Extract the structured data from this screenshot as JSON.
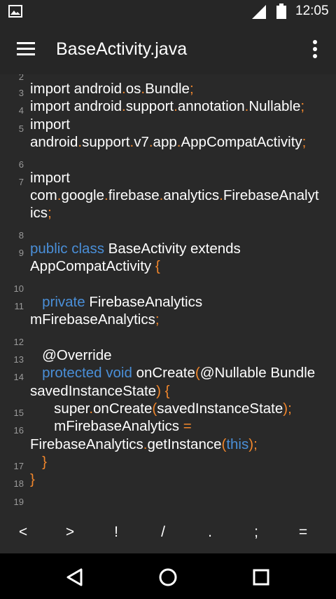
{
  "status_bar": {
    "time": "12:05"
  },
  "toolbar": {
    "title": "BaseActivity.java"
  },
  "editor": {
    "line_numbers": [
      "2",
      "3",
      "4",
      "5",
      "6",
      "7",
      "8",
      "9",
      "10",
      "11",
      "12",
      "13",
      "14",
      "15",
      "16",
      "17",
      "18",
      "19"
    ],
    "code_text": {
      "l3": "import android.os.Bundle;",
      "l4": "import android.support.annotation.Nullable;",
      "l5a": "import",
      "l5b": "android.support.v7.app.AppCompatActivity;",
      "l7a": "import",
      "l7b": "com.google.firebase.analytics.FirebaseAnalyt",
      "l7c": "ics;",
      "l9a": "public class BaseActivity extends",
      "l9b": "AppCompatActivity {",
      "l11a": "private FirebaseAnalytics",
      "l11b": "mFirebaseAnalytics;",
      "l13": "@Override",
      "l14a": "protected void onCreate(@Nullable Bundle",
      "l14b": "savedInstanceState) {",
      "l15": "super.onCreate(savedInstanceState);",
      "l16a": "mFirebaseAnalytics =",
      "l16b": "FirebaseAnalytics.getInstance(this);",
      "l17": "}",
      "l18": "}"
    }
  },
  "symbol_bar": {
    "keys": [
      "<",
      ">",
      "!",
      "/",
      ".",
      ";",
      "="
    ]
  },
  "colors": {
    "keyword": "#4a8fd8",
    "operator": "#f0862c",
    "background": "#292929"
  }
}
